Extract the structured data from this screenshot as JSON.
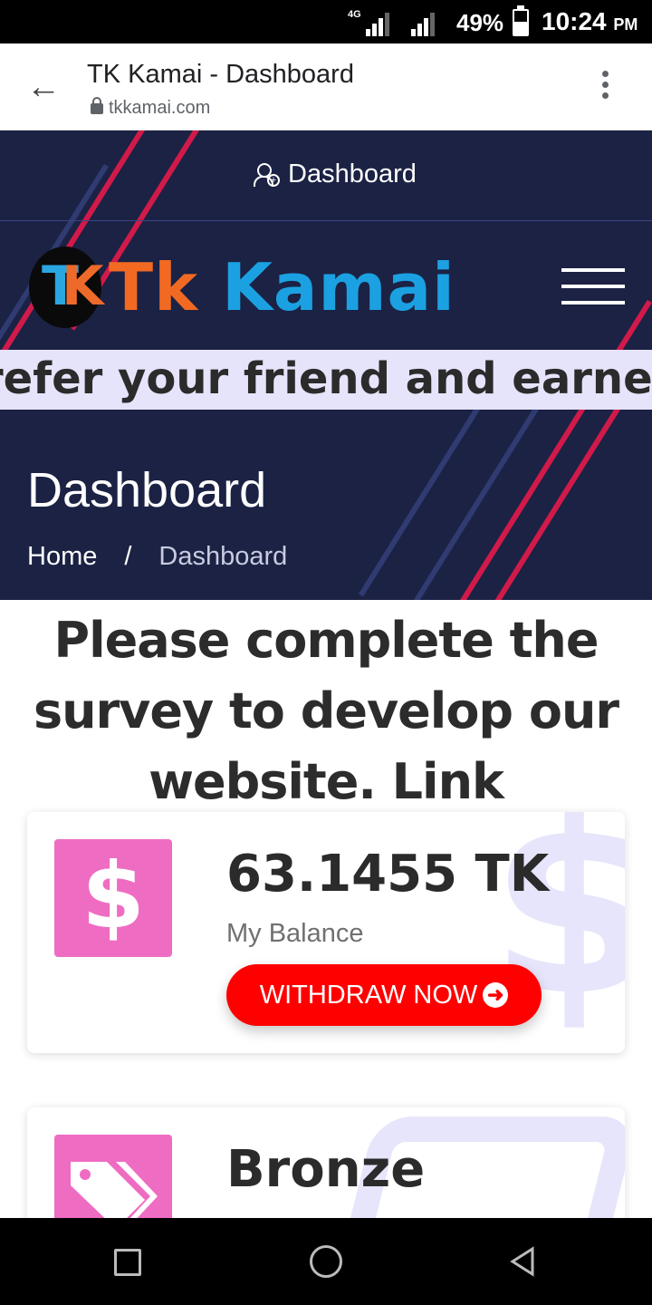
{
  "status_bar": {
    "network": "4G",
    "battery_percent": "49%",
    "battery_level": 0.49,
    "time": "10:24",
    "ampm": "PM"
  },
  "browser": {
    "page_title": "TK Kamai - Dashboard",
    "url": "tkkamai.com"
  },
  "header": {
    "top_link": "Dashboard",
    "logo_tk": "Tk",
    "logo_kamai": "Kamai",
    "logo_mark": "TK"
  },
  "marquee": {
    "text": "refer your friend and earned at"
  },
  "page": {
    "title": "Dashboard",
    "breadcrumb_home": "Home",
    "breadcrumb_sep": "/",
    "breadcrumb_current": "Dashboard"
  },
  "notice": {
    "text": "Please complete the survey to develop our website. Link"
  },
  "balance_card": {
    "amount": "63.1455 TK",
    "label": "My Balance",
    "button": "WITHDRAW NOW",
    "icon": "dollar-icon"
  },
  "bronze_card": {
    "title": "Bronze",
    "icon": "tags-icon"
  },
  "colors": {
    "hero_bg": "#1b2244",
    "accent_red": "#ff0000",
    "icon_pink": "#ef6cc3",
    "logo_orange": "#f26a22",
    "logo_blue": "#1ba1e2"
  }
}
